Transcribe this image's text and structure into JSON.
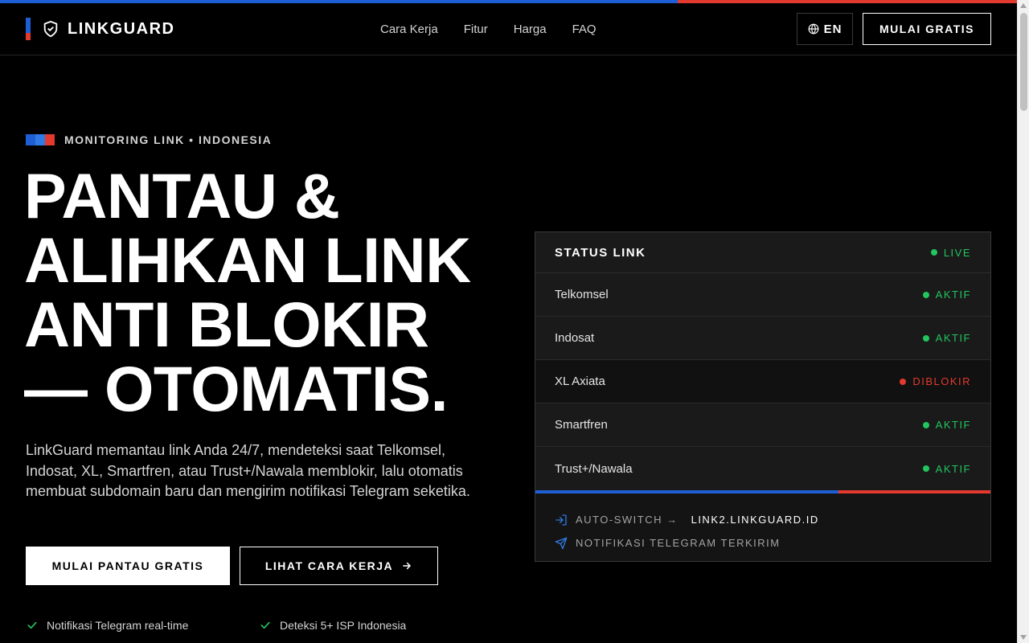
{
  "colors": {
    "blue": "#1f5fd6",
    "red": "#e23a2e",
    "green": "#22c55e",
    "white": "#ffffff"
  },
  "brand": {
    "name": "LINKGUARD",
    "icon": "shield-check-icon"
  },
  "nav": {
    "items": [
      "Cara Kerja",
      "Fitur",
      "Harga",
      "FAQ"
    ]
  },
  "header": {
    "lang_label": "EN",
    "lang_icon": "globe-icon",
    "cta_label": "MULAI GRATIS"
  },
  "hero": {
    "eyebrow": "MONITORING LINK • INDONESIA",
    "title_lines": [
      "PANTAU &",
      "ALIHKAN LINK",
      "ANTI BLOKIR",
      "— OTOMATIS."
    ],
    "description": "LinkGuard memantau link Anda 24/7, mendeteksi saat Telkomsel, Indosat, XL, Smartfren, atau Trust+/Nawala memblokir, lalu otomatis membuat subdomain baru dan mengirim notifikasi Telegram seketika.",
    "primary_cta": "MULAI PANTAU GRATIS",
    "secondary_cta": "LIHAT CARA KERJA",
    "secondary_cta_icon": "arrow-right-icon",
    "features": [
      "Notifikasi Telegram real-time",
      "Deteksi 5+ ISP Indonesia"
    ]
  },
  "status_card": {
    "title": "STATUS LINK",
    "live_label": "LIVE",
    "rows": [
      {
        "name": "Telkomsel",
        "status": "AKTIF",
        "state": "ok"
      },
      {
        "name": "Indosat",
        "status": "AKTIF",
        "state": "ok"
      },
      {
        "name": "XL Axiata",
        "status": "DIBLOKIR",
        "state": "blocked"
      },
      {
        "name": "Smartfren",
        "status": "AKTIF",
        "state": "ok"
      },
      {
        "name": "Trust+/Nawala",
        "status": "AKTIF",
        "state": "ok"
      }
    ],
    "auto_switch_label": "AUTO-SWITCH →",
    "auto_switch_target": "LINK2.LINKGUARD.ID",
    "telegram_label": "NOTIFIKASI TELEGRAM TERKIRIM"
  }
}
